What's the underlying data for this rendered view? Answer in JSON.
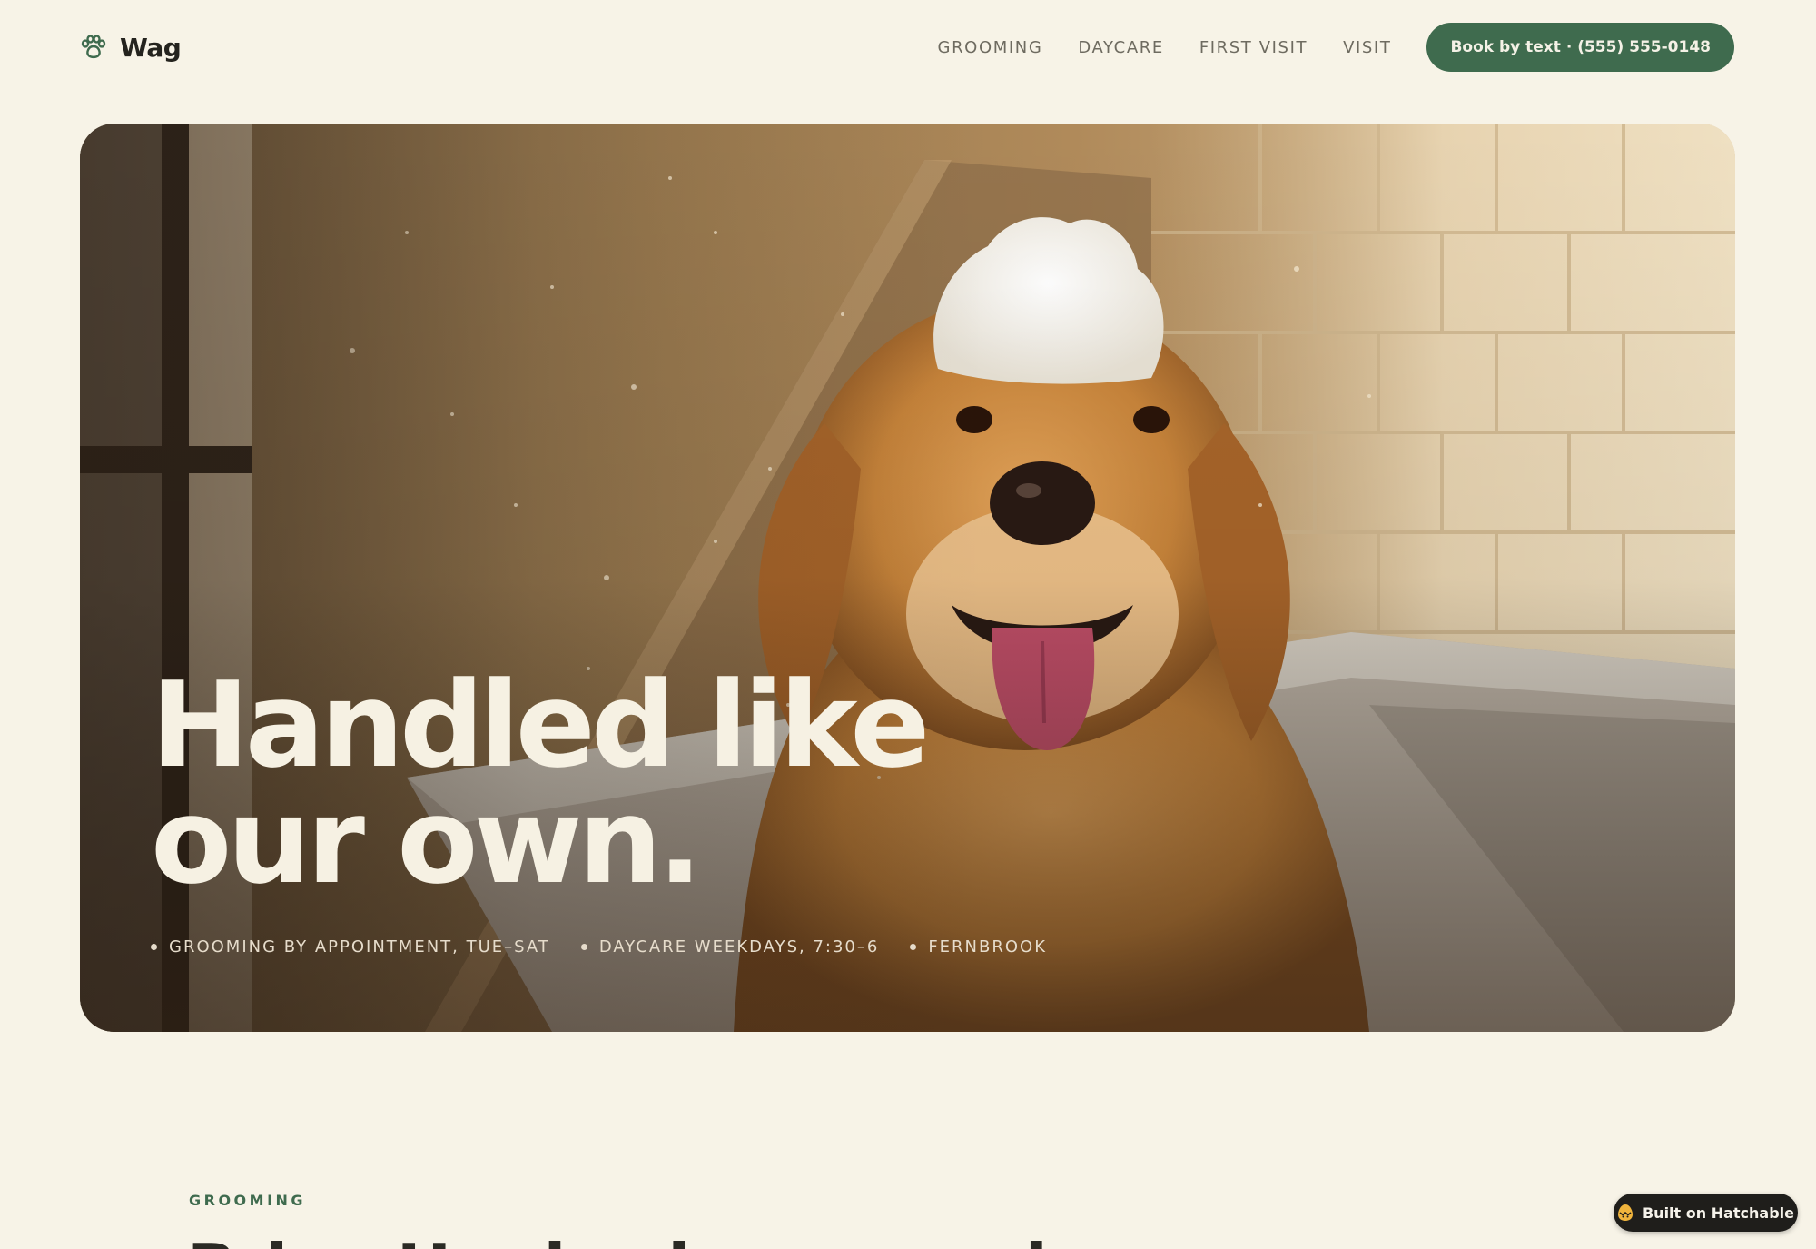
{
  "header": {
    "brand": "Wag",
    "nav": [
      "GROOMING",
      "DAYCARE",
      "FIRST VISIT",
      "VISIT"
    ],
    "cta_label": "Book by text · (555) 555-0148"
  },
  "hero": {
    "headline_line1": "Handled like",
    "headline_line2": "our own.",
    "facts": [
      "GROOMING BY APPOINTMENT, TUE–SAT",
      "DAYCARE WEEKDAYS, 7:30–6",
      "FERNBROOK"
    ],
    "image_subject": "golden retriever in a bath tub with soap foam on its head"
  },
  "section": {
    "eyebrow": "GROOMING",
    "title": "Bring Her back groomed"
  },
  "badge": {
    "label": "Built on Hatchable"
  },
  "colors": {
    "background": "#f7f3e7",
    "accent_green": "#3f6b4e",
    "headline": "#f6f1e3",
    "badge_bg": "#1f1e1b"
  },
  "icons": {
    "logo": "paw-icon",
    "badge": "egg-icon"
  }
}
